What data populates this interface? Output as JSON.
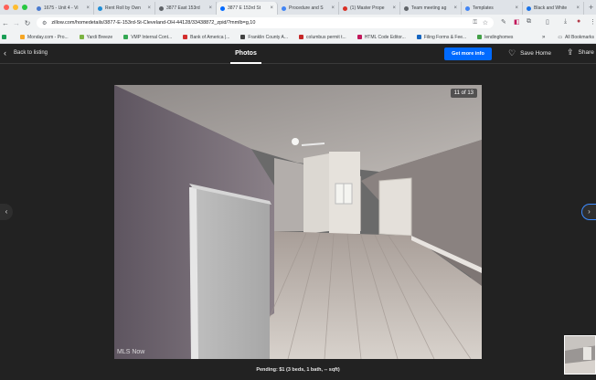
{
  "browser": {
    "tabs": [
      {
        "title": "1675 - Unit 4 - Vi",
        "color": "#4a7bd0",
        "active": false
      },
      {
        "title": "Rent Roll by Own",
        "color": "#1f8dd6",
        "active": false
      },
      {
        "title": "3877 East 153rd",
        "color": "#5f6368",
        "active": false
      },
      {
        "title": "3877 E 153rd St",
        "color": "#006aff",
        "active": true
      },
      {
        "title": "Procedure and S",
        "color": "#4285f4",
        "active": false
      },
      {
        "title": "(1) Master Prope",
        "color": "#d93025",
        "active": false
      },
      {
        "title": "Team meeting ag",
        "color": "#5f6368",
        "active": false
      },
      {
        "title": "Templates",
        "color": "#4285f4",
        "active": false
      },
      {
        "title": "Black and White",
        "color": "#1a73e8",
        "active": false
      }
    ],
    "url": "zillow.com/homedetails/3877-E-153rd-St-Cleveland-OH-44128/33438872_zpid/?mmlb=g,10",
    "bookmarks": [
      {
        "label": "",
        "color": "#1a9e55"
      },
      {
        "label": "Monday.com - Pro...",
        "color": "#f6a623"
      },
      {
        "label": "Yardi Breeze",
        "color": "#7cb342"
      },
      {
        "label": "VMP Internal Cont...",
        "color": "#34a853"
      },
      {
        "label": "Bank of America |...",
        "color": "#d32f2f"
      },
      {
        "label": "Franklin County A...",
        "color": "#424242"
      },
      {
        "label": "columbus permit t...",
        "color": "#c62828"
      },
      {
        "label": "HTML Code Editor...",
        "color": "#c2185b"
      },
      {
        "label": "Filing Forms & Fee...",
        "color": "#1565c0"
      },
      {
        "label": "lendinghomes",
        "color": "#43a047"
      }
    ],
    "bookmarks_more": "»",
    "all_bookmarks": "All Bookmarks"
  },
  "viewer": {
    "back_label": "Back to listing",
    "tab_label": "Photos",
    "get_info_label": "Get more info",
    "save_label": "Save Home",
    "share_label": "Share",
    "counter": "11 of 13",
    "watermark": "MLS Now",
    "caption": "Pending: $1 (3 beds, 1 bath, -- sqft)",
    "accent": "#006aff"
  }
}
